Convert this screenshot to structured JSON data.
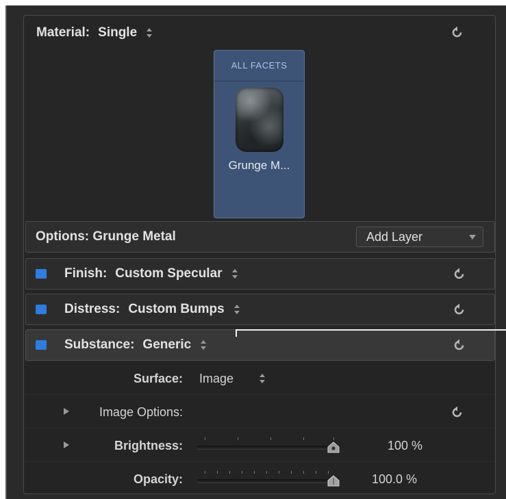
{
  "material": {
    "label": "Material:",
    "value": "Single",
    "facet_title": "ALL FACETS",
    "facet_name": "Grunge M..."
  },
  "options": {
    "label": "Options: Grunge Metal",
    "add_layer": "Add Layer"
  },
  "layers": [
    {
      "label": "Finish:",
      "value": "Custom Specular",
      "enabled": true
    },
    {
      "label": "Distress:",
      "value": "Custom Bumps",
      "enabled": true
    },
    {
      "label": "Substance:",
      "value": "Generic",
      "enabled": true
    }
  ],
  "substance": {
    "surface_label": "Surface:",
    "surface_value": "Image",
    "image_options_label": "Image Options:",
    "brightness_label": "Brightness:",
    "brightness_value": "100 %",
    "brightness_level": 1.0,
    "opacity_label": "Opacity:",
    "opacity_value": "100.0 %",
    "opacity_level": 1.0
  },
  "colors": {
    "checkbox": "#2e7de0",
    "facet_bg": "#3d5476",
    "facet_title": "#a9c3ee"
  },
  "icons": {
    "reset": "reset-arrow-icon",
    "stepper": "up-down-stepper-icon",
    "disclosure": "disclosure-triangle-icon",
    "dropdown": "chevron-down-icon"
  }
}
